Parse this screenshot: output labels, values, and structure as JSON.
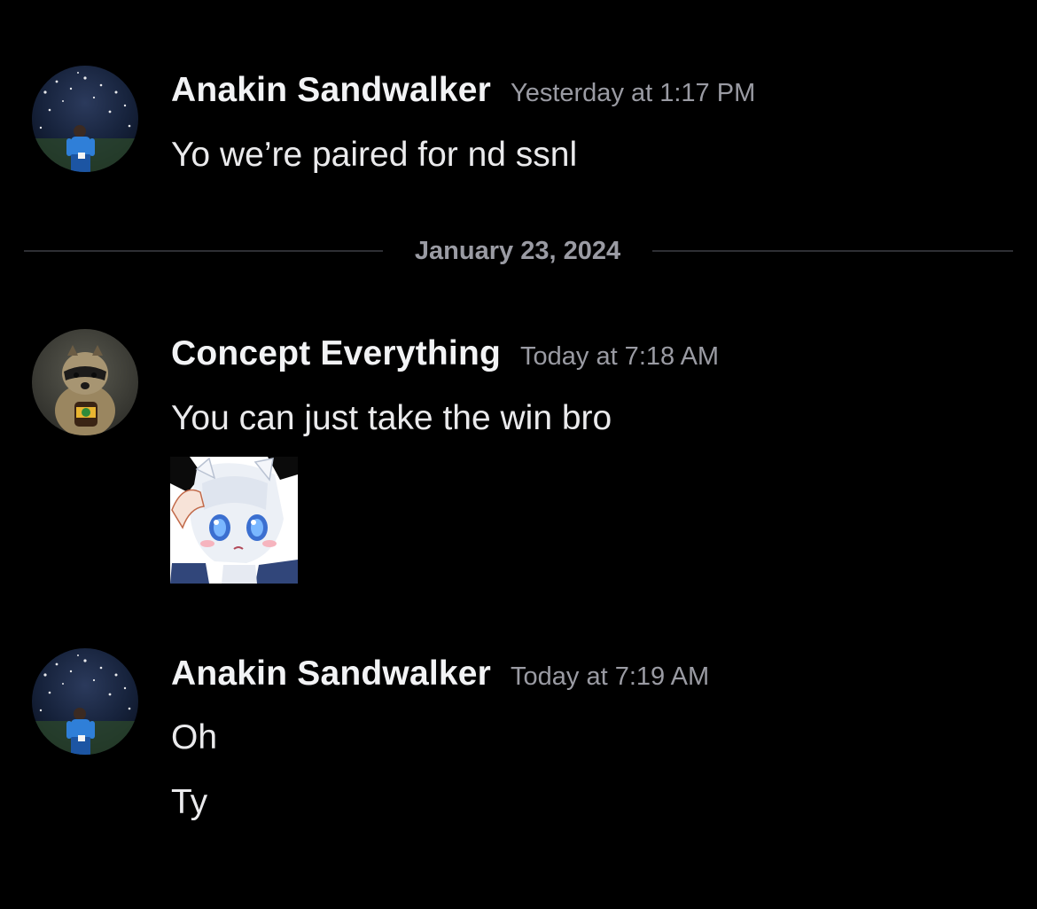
{
  "messages": [
    {
      "author": "Anakin Sandwalker",
      "timestamp": "Yesterday at 1:17 PM",
      "lines": [
        "Yo we’re paired for nd ssnl"
      ],
      "avatar_icon": "cricket-player-avatar"
    },
    {
      "author": "Concept Everything",
      "timestamp": "Today at 7:18 AM",
      "lines": [
        "You can just take the win bro"
      ],
      "avatar_icon": "raccoon-avatar",
      "attachment": "anime-salute-sticker"
    },
    {
      "author": "Anakin Sandwalker",
      "timestamp": "Today at 7:19 AM",
      "lines": [
        "Oh",
        "Ty"
      ],
      "avatar_icon": "cricket-player-avatar"
    }
  ],
  "date_divider": "January 23, 2024",
  "colors": {
    "background": "#000000",
    "username": "#f2f3f5",
    "timestamp": "#9a9ba3",
    "message_text": "#eaeaec",
    "divider_line": "#2e2f34"
  }
}
